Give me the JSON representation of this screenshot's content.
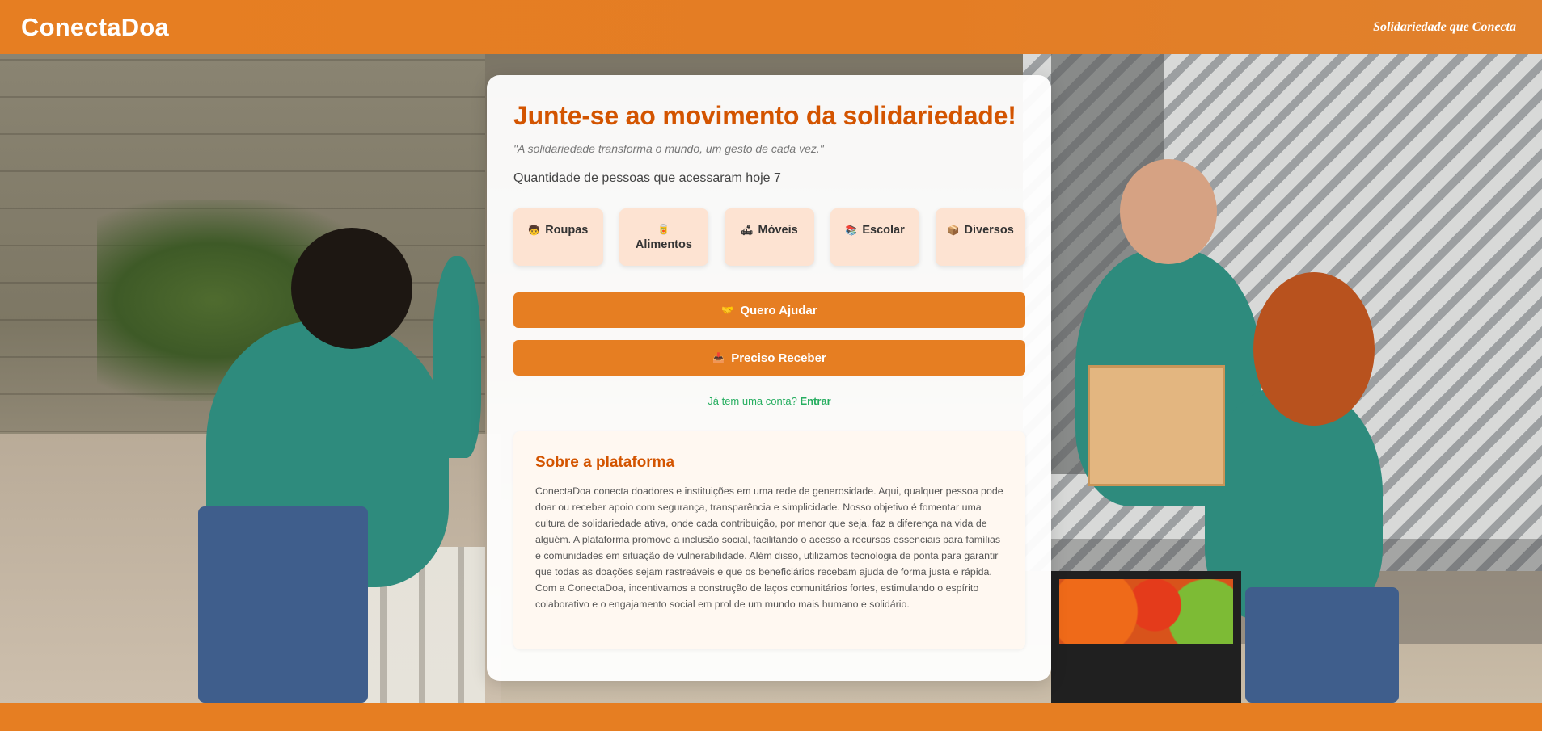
{
  "header": {
    "logo": "ConectaDoa",
    "tagline": "Solidariedade que Conecta"
  },
  "card": {
    "title": "Junte-se ao movimento da solidariedade!",
    "quote": "\"A solidariedade transforma o mundo, um gesto de cada vez.\"",
    "visits_label": "Quantidade de pessoas que acessaram hoje",
    "visits_count": "7",
    "categories": [
      {
        "icon": "🧒",
        "icon_name": "child-icon",
        "label": "Roupas"
      },
      {
        "icon": "🥫",
        "icon_name": "can-icon",
        "label": "Alimentos"
      },
      {
        "icon": "🛋",
        "icon_name": "couch-icon",
        "label": "Móveis"
      },
      {
        "icon": "📚",
        "icon_name": "books-icon",
        "label": "Escolar"
      },
      {
        "icon": "📦",
        "icon_name": "box-icon",
        "label": "Diversos"
      }
    ],
    "help_button": {
      "icon": "🤝",
      "label": "Quero Ajudar"
    },
    "receive_button": {
      "icon": "📥",
      "label": "Preciso Receber"
    },
    "login_prompt": "Já tem uma conta?",
    "login_link": "Entrar"
  },
  "about": {
    "title": "Sobre a plataforma",
    "text": "ConectaDoa conecta doadores e instituições em uma rede de generosidade. Aqui, qualquer pessoa pode doar ou receber apoio com segurança, transparência e simplicidade. Nosso objetivo é fomentar uma cultura de solidariedade ativa, onde cada contribuição, por menor que seja, faz a diferença na vida de alguém. A plataforma promove a inclusão social, facilitando o acesso a recursos essenciais para famílias e comunidades em situação de vulnerabilidade. Além disso, utilizamos tecnologia de ponta para garantir que todas as doações sejam rastreáveis e que os beneficiários recebam ajuda de forma justa e rápida. Com a ConectaDoa, incentivamos a construção de laços comunitários fortes, estimulando o espírito colaborativo e o engajamento social em prol de um mundo mais humano e solidário."
  },
  "colors": {
    "brand_orange": "#e67e22",
    "title_orange": "#d35400",
    "link_green": "#27ae60",
    "category_bg": "#fde3d2"
  }
}
